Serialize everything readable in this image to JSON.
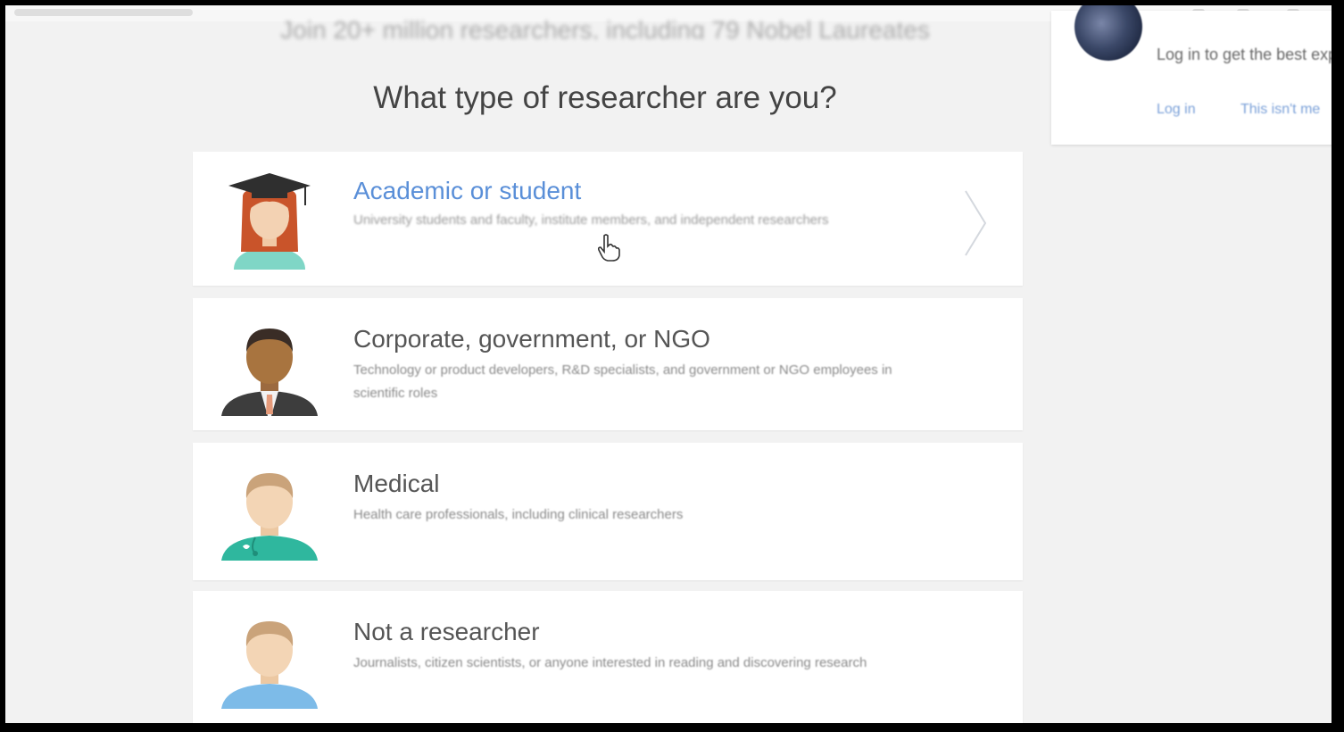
{
  "headline": "Join 20+ million researchers, including 79 Nobel Laureates",
  "question": "What type of researcher are you?",
  "options": [
    {
      "title": "Academic or student",
      "description": "University students and faculty, institute members, and independent researchers",
      "avatar_icon": "graduate-avatar-icon"
    },
    {
      "title": "Corporate, government, or NGO",
      "description": "Technology or product developers, R&D specialists, and government or NGO employees in scientific roles",
      "avatar_icon": "businessman-avatar-icon"
    },
    {
      "title": "Medical",
      "description": "Health care professionals, including clinical researchers",
      "avatar_icon": "medical-avatar-icon"
    },
    {
      "title": "Not a researcher",
      "description": "Journalists, citizen scientists, or anyone interested in reading and discovering research",
      "avatar_icon": "person-avatar-icon"
    }
  ],
  "login_popup": {
    "text": "Log in to get the best experience on ResearchGate",
    "login_link": "Log in",
    "not_me_link": "This isn't me"
  },
  "colors": {
    "accent_link": "#5a8fd8",
    "background": "#f2f2f2",
    "card": "#ffffff",
    "frame_border": "#000000"
  }
}
